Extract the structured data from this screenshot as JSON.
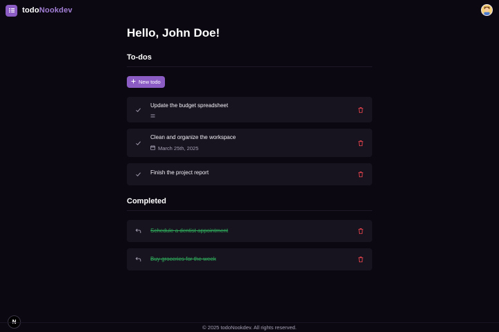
{
  "app": {
    "brand_prefix": "todo",
    "brand_suffix": "Nookdev"
  },
  "user": {
    "avatar_icon": "user-avatar-icon"
  },
  "greeting": "Hello, John Doe!",
  "todos": {
    "title": "To-dos",
    "new_button_label": "New todo",
    "items": [
      {
        "title": "Update the budget spreadsheet",
        "has_notes": true,
        "date": ""
      },
      {
        "title": "Clean and organize the workspace",
        "has_notes": false,
        "date": "March 25th, 2025"
      },
      {
        "title": "Finish the project report",
        "has_notes": false,
        "date": ""
      }
    ]
  },
  "completed": {
    "title": "Completed",
    "items": [
      {
        "title": "Schedule a dentist appointment"
      },
      {
        "title": "Buy groceries for the week"
      }
    ]
  },
  "footer": {
    "text": "© 2025 todoNookdev. All rights reserved."
  },
  "dev_badge": {
    "label": "N"
  },
  "colors": {
    "background": "#0c0812",
    "card": "#17131f",
    "accent": "#8b5cc4",
    "brand_suffix": "#a27fd6",
    "completed_text": "#2fa95a",
    "delete": "#e0434b"
  }
}
